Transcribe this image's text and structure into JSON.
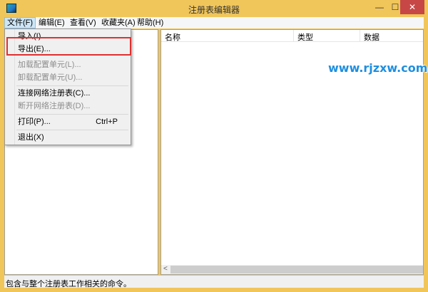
{
  "window": {
    "title": "注册表编辑器",
    "min": "—",
    "max": "☐",
    "close": "✕"
  },
  "menubar": [
    "文件(F)",
    "编辑(E)",
    "查看(V)",
    "收藏夹(A)",
    "帮助(H)"
  ],
  "file_menu": {
    "items": [
      {
        "label": "导入(I)..."
      },
      {
        "label": "导出(E)..."
      },
      {
        "label": "加载配置单元(L)..."
      },
      {
        "label": "卸载配置单元(U)..."
      },
      {
        "label": "连接网络注册表(C)..."
      },
      {
        "label": "断开网络注册表(D)..."
      },
      {
        "label": "打印(P)...",
        "shortcut": "Ctrl+P"
      },
      {
        "label": "退出(X)"
      }
    ]
  },
  "columns": [
    "名称",
    "类型",
    "数据"
  ],
  "scroll_arrow": "<",
  "status": "包含与整个注册表工作相关的命令。",
  "watermark": "www.rjzxw.com"
}
